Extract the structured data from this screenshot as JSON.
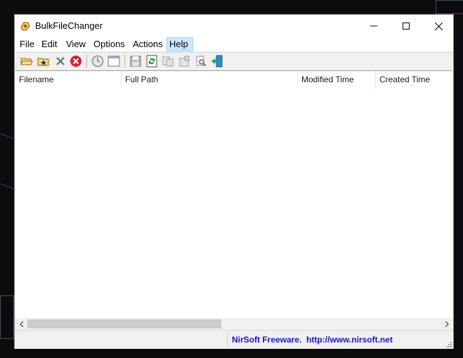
{
  "window": {
    "title": "BulkFileChanger"
  },
  "menubar": {
    "items": [
      {
        "label": "File"
      },
      {
        "label": "Edit"
      },
      {
        "label": "View"
      },
      {
        "label": "Options"
      },
      {
        "label": "Actions"
      },
      {
        "label": "Help"
      }
    ],
    "highlighted": "Help"
  },
  "toolbar": {
    "icons": [
      "open-folder-icon",
      "add-files-icon",
      "delete-icon",
      "stop-icon",
      "clock-icon",
      "window-icon",
      "save-icon",
      "refresh-icon",
      "copy-icon",
      "properties-icon",
      "find-icon",
      "exit-icon"
    ]
  },
  "list": {
    "columns": [
      {
        "label": "Filename"
      },
      {
        "label": "Full Path"
      },
      {
        "label": "Modified Time"
      },
      {
        "label": "Created Time"
      }
    ],
    "rows": []
  },
  "status": {
    "text": "NirSoft Freeware.  http://www.nirsoft.net"
  },
  "colors": {
    "link": "#1414d8",
    "menu_highlight": "#cce8ff",
    "desktop": "#0c0c0e"
  }
}
